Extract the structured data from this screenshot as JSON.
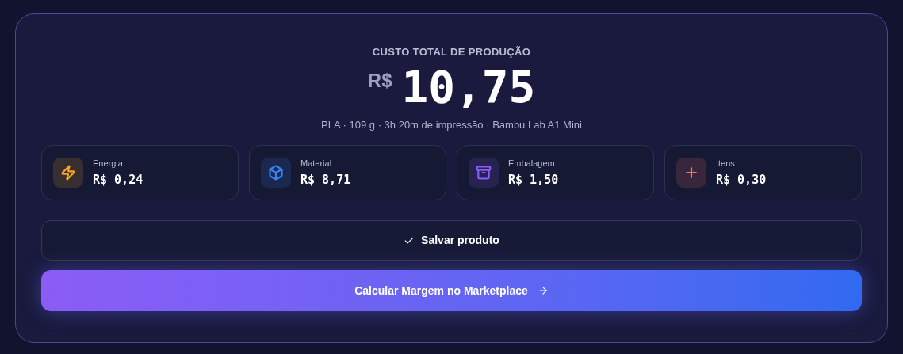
{
  "summary": {
    "label": "CUSTO TOTAL DE PRODUÇÃO",
    "currency": "R$",
    "total": "10,75",
    "details": "PLA · 109 g · 3h 20m de impressão · Bambu Lab A1 Mini"
  },
  "costs": [
    {
      "kind": "energy",
      "label": "Energia",
      "value": "R$ 0,24",
      "color": "#f5a524"
    },
    {
      "kind": "material",
      "label": "Material",
      "value": "R$ 8,71",
      "color": "#3b82f6"
    },
    {
      "kind": "packaging",
      "label": "Embalagem",
      "value": "R$ 1,50",
      "color": "#8b5cf6"
    },
    {
      "kind": "items",
      "label": "Itens",
      "value": "R$ 0,30",
      "color": "#f87171"
    }
  ],
  "actions": [
    {
      "kind": "secondary",
      "label": "Salvar produto"
    },
    {
      "kind": "primary",
      "label": "Calcular Margem no Marketplace"
    }
  ]
}
